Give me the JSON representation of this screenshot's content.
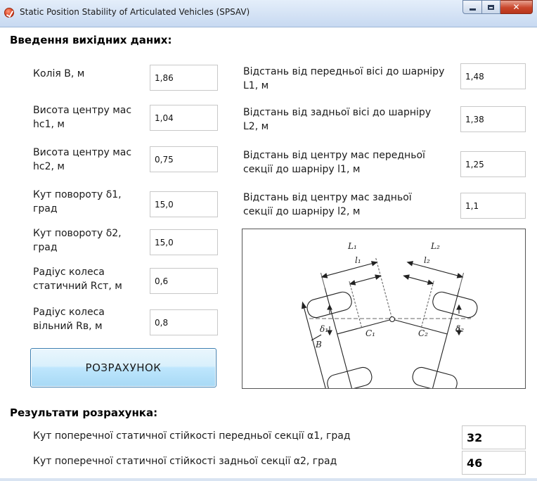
{
  "window": {
    "title": "Static Position Stability of Articulated Vehicles (SPSAV)",
    "controls": {
      "minimize": "–",
      "maximize": "□",
      "close": "✕"
    }
  },
  "input_section": {
    "title": "Введення вихідних даних:",
    "left_fields": [
      {
        "label": "Колія B, м",
        "value": "1,86"
      },
      {
        "label": "Висота центру мас hc1, м",
        "value": "1,04"
      },
      {
        "label": "Висота центру мас hc2, м",
        "value": "0,75"
      },
      {
        "label": "Кут повороту δ1, град",
        "value": "15,0"
      },
      {
        "label": "Кут повороту δ2, град",
        "value": "15,0"
      },
      {
        "label": "Радіус колеса статичний Rст, м",
        "value": "0,6"
      },
      {
        "label": "Радіус колеса вільний Rв, м",
        "value": "0,8"
      }
    ],
    "right_fields": [
      {
        "label": "Відстань від передньої вісі до шарніру L1, м",
        "value": "1,48"
      },
      {
        "label": "Відстань від задньої вісі до шарніру L2, м",
        "value": "1,38"
      },
      {
        "label": "Відстань від центру мас передньої секції до шарніру l1, м",
        "value": "1,25"
      },
      {
        "label": "Відстань від центру мас задньої секції до шарніру l2, м",
        "value": "1,1"
      }
    ],
    "calculate_button": "РОЗРАХУНОК"
  },
  "diagram": {
    "labels": {
      "L1": "L₁",
      "L2": "L₂",
      "l1": "l₁",
      "l2": "l₂",
      "d1": "δ₁",
      "d2": "δ₂",
      "B": "B",
      "C1": "C₁",
      "C2": "C₂"
    }
  },
  "results_section": {
    "title": "Результати розрахунка:",
    "rows": [
      {
        "label": "Кут поперечної статичної стійкості передньої секції α1, град",
        "value": "32"
      },
      {
        "label": "Кут поперечної статичної стійкості задньої секції α2, град",
        "value": "46"
      }
    ]
  }
}
